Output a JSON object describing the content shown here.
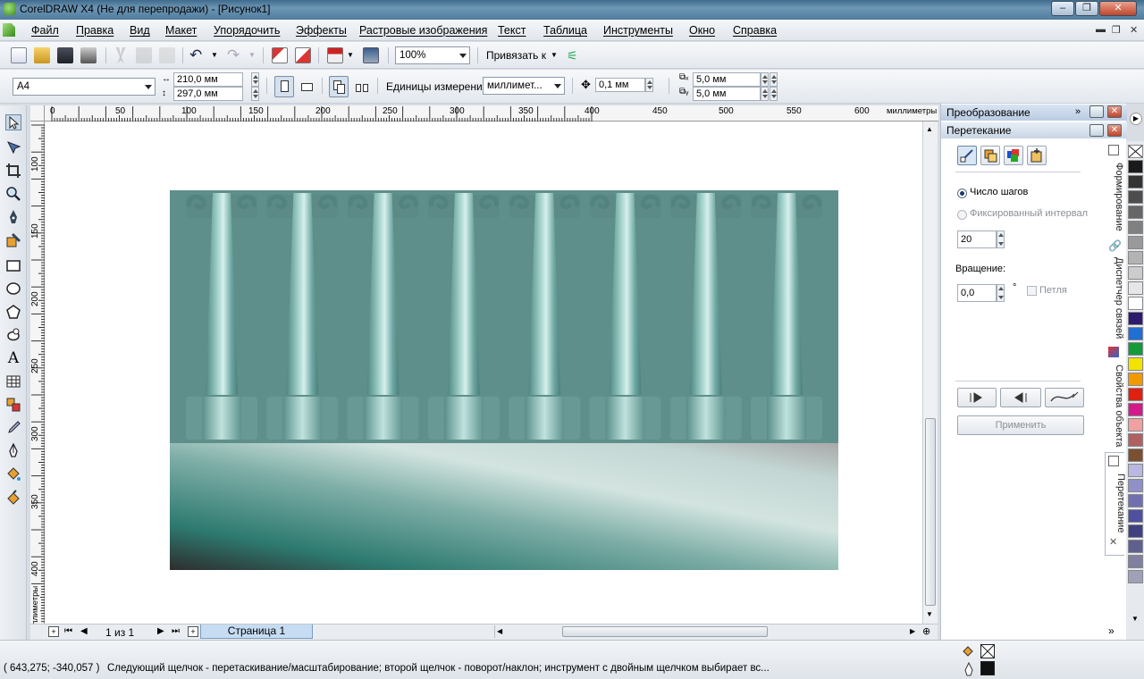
{
  "window": {
    "title": "CorelDRAW X4 (Не для перепродажи) - [Рисунок1]"
  },
  "menu": [
    "Файл",
    "Правка",
    "Вид",
    "Макет",
    "Упорядочить",
    "Эффекты",
    "Растровые изображения",
    "Текст",
    "Таблица",
    "Инструменты",
    "Окно",
    "Справка"
  ],
  "standard_toolbar": {
    "zoom": "100%",
    "snap_label": "Привязать к"
  },
  "property_bar": {
    "paper_size": "A4",
    "width": "210,0 мм",
    "height": "297,0 мм",
    "units_label": "Единицы измерения:",
    "units_value": "миллимет...",
    "nudge": "0,1 мм",
    "dup_x": "5,0 мм",
    "dup_y": "5,0 мм"
  },
  "ruler": {
    "h_ticks": [
      "0",
      "50",
      "100",
      "150",
      "200",
      "250",
      "300",
      "350",
      "400",
      "450",
      "500",
      "550",
      "600"
    ],
    "h_units": "миллиметры",
    "v_ticks": [
      "100",
      "150",
      "200",
      "250",
      "300",
      "350",
      "400"
    ],
    "v_units": "миллиметры"
  },
  "docker": {
    "panel1_title": "Преобразование",
    "panel2_title": "Перетекание",
    "steps_label": "Число шагов",
    "fixed_label": "Фиксированный интервал",
    "steps_value": "20",
    "rotation_label": "Вращение:",
    "rotation_value": "0,0",
    "degree": "°",
    "loop_label": "Петля",
    "apply_label": "Применить",
    "selected_option": "Число шагов"
  },
  "side_tabs": [
    "Формирование",
    "Диспетчер связей",
    "Свойства объекта",
    "Перетекание"
  ],
  "pagenav": {
    "counter": "1 из 1",
    "page_tab": "Страница 1"
  },
  "status": {
    "coords": "( 643,275; -340,057 )",
    "message": "Следующий щелчок - перетаскивание/масштабирование; второй щелчок - поворот/наклон; инструмент с двойным щелчком выбирает вс..."
  },
  "palette": [
    "#ffffff",
    "#1a1a1a",
    "#333333",
    "#4d4d4d",
    "#666666",
    "#808080",
    "#999999",
    "#b3b3b3",
    "#cccccc",
    "#e6e6e6",
    "#ffffff",
    "#2e1a6e",
    "#1f6fd6",
    "#139a3a",
    "#f0e400",
    "#f09a00",
    "#e02010",
    "#d41a8a",
    "#f0a0a0",
    "#b06060",
    "#7a5030",
    "#b8b8e0",
    "#9090c8",
    "#7070b0",
    "#5050a0",
    "#404080",
    "#606090",
    "#8080a0",
    "#a0a0b8"
  ],
  "colors": {
    "canvas_teal": "#5c8c88",
    "accent": "#2f5f8f"
  }
}
